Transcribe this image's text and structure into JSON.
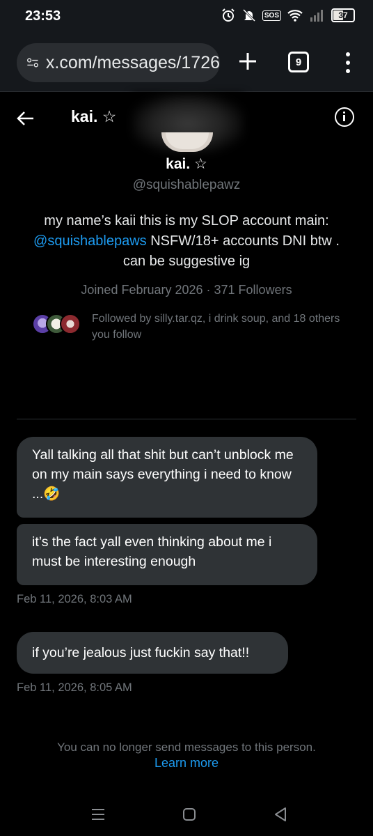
{
  "status_bar": {
    "time": "23:53",
    "sos": "SOS",
    "battery": "37"
  },
  "browser": {
    "url": "x.com/messages/1726",
    "tab_count": "9"
  },
  "header": {
    "name": "kai. ☆"
  },
  "profile": {
    "name": "kai. ☆",
    "handle": "@squishablepawz",
    "bio_before": "my name’s kaii this is my SLOP account main: ",
    "bio_mention": "@squishablepaws",
    "bio_after": " NSFW/18+ accounts DNI btw . can be suggestive ig",
    "meta": "Joined February 2026 · 371 Followers",
    "followed_by": "Followed by silly.tar.qz, i drink soup, and 18 others you follow"
  },
  "messages": [
    {
      "text": "Yall talking all that shit but can’t unblock me on my main says everything i need to know ...🤣"
    },
    {
      "text": "it’s the fact yall even thinking about me i must be interesting enough"
    },
    {
      "text": "if you’re jealous just fuckin say that!!"
    }
  ],
  "timestamps": [
    "Feb 11, 2026, 8:03 AM",
    "Feb 11, 2026, 8:05 AM"
  ],
  "notice": {
    "text": "You can no longer send messages to this person.",
    "link": "Learn more"
  },
  "colors": {
    "background": "#000000",
    "bubble": "#2f3336",
    "link": "#1d9bf0",
    "muted": "#71767b"
  }
}
